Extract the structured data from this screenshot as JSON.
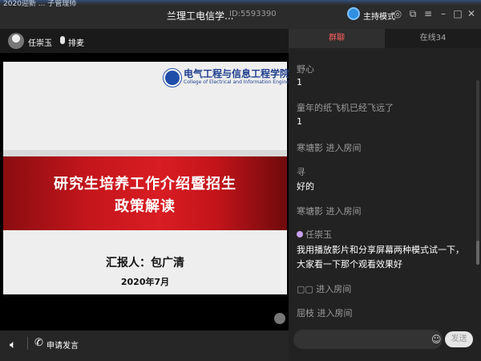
{
  "desktop": {
    "partial_text": "2020迎新 ... 子管理师"
  },
  "window": {
    "title": "兰理工电信学...",
    "room_id": "ID:5593390",
    "host_mode": "主持模式",
    "controls": [
      "settings-icon",
      "popout-icon",
      "menu-icon",
      "minimize-icon",
      "maximize-icon",
      "close-icon"
    ]
  },
  "video": {
    "user_name": "任崇玉",
    "mic_label": "排麦",
    "slide": {
      "college_cn": "电气工程与信息工程学院",
      "college_en": "College of Electrical and Information Engineering",
      "title_line1": "研究生培养工作介绍暨招生",
      "title_line2": "政策解读",
      "reporter": "汇报人：包广清",
      "date": "2020年7月"
    },
    "apply_speak": "申请发言"
  },
  "chat": {
    "tabs": [
      {
        "label": "群聊",
        "active": true
      },
      {
        "label": "在线34",
        "active": false
      }
    ],
    "messages": [
      {
        "type": "nick",
        "text": "野心"
      },
      {
        "type": "body",
        "text": "1"
      },
      {
        "type": "nick",
        "text": "童年的纸飞机已经飞远了"
      },
      {
        "type": "body",
        "text": "1"
      },
      {
        "type": "sys",
        "text": "寒塘影 进入房间"
      },
      {
        "type": "nick",
        "text": "寻"
      },
      {
        "type": "body",
        "text": "好的"
      },
      {
        "type": "sys",
        "text": "寒塘影 进入房间"
      },
      {
        "type": "nick",
        "text": "任崇玉"
      },
      {
        "type": "body",
        "text": "我用播放影片和分享屏幕两种模式试一下，"
      },
      {
        "type": "body",
        "text": "大家看一下那个观看效果好"
      },
      {
        "type": "sys",
        "text": "▢▢ 进入房间"
      },
      {
        "type": "sys",
        "text": "屈枝 进入房间"
      }
    ],
    "input_placeholder": "",
    "send_label": "发送"
  }
}
